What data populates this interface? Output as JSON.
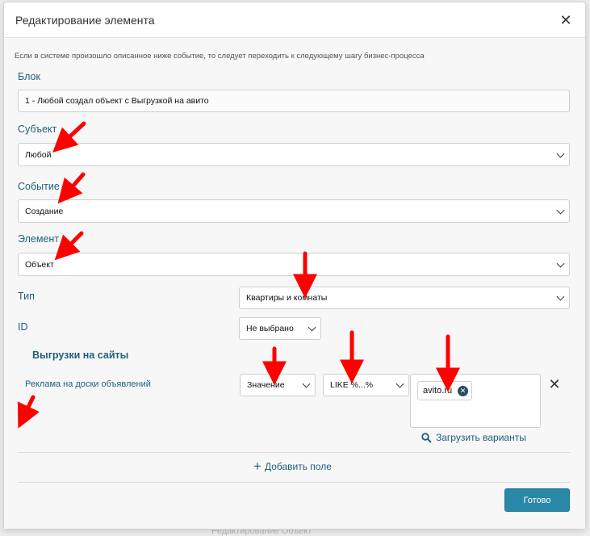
{
  "modal": {
    "title": "Редактирование элемента",
    "hint": "Если в системе произошло описанное ниже событие, то следует переходить к следующему шагу бизнес-процесса"
  },
  "block": {
    "label": "Блок",
    "value": "1 - Любой создал объект с Выгрузкой на авито"
  },
  "subject": {
    "label": "Субъект",
    "value": "Любой"
  },
  "event": {
    "label": "Событие",
    "value": "Создание"
  },
  "element": {
    "label": "Элемент",
    "value": "Объект"
  },
  "type": {
    "label": "Тип",
    "value": "Квартиры и комнаты"
  },
  "id": {
    "label": "ID",
    "value": "Не выбрано"
  },
  "exports": {
    "heading": "Выгрузки на сайты"
  },
  "condition": {
    "field_link": "Реклама на доски объявлений",
    "mode": "Значение",
    "operator": "LIKE %...%",
    "tags": [
      "avito.ru"
    ],
    "load_variants": "Загрузить варианты"
  },
  "add_field": "Добавить поле",
  "done_button": "Готово",
  "background": {
    "partial_text": "Редактирование Объект"
  },
  "colors": {
    "annotation_arrow": "#ff0000",
    "accent": "#2a87a8",
    "label": "#1f5f7a"
  }
}
